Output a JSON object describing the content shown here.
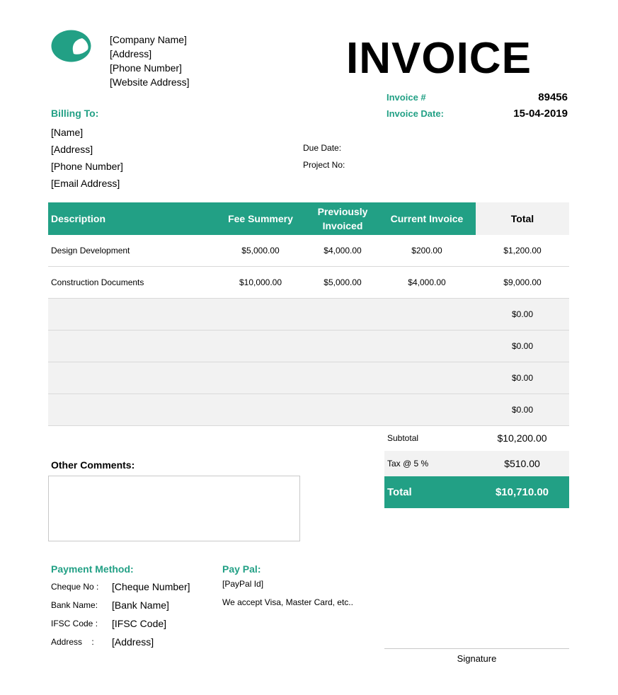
{
  "brand": {
    "accent": "#22a085",
    "logo_icon": "crescent-logo-icon"
  },
  "company": {
    "name": "[Company Name]",
    "address": "[Address]",
    "phone": "[Phone Number]",
    "website": "[Website Address]"
  },
  "title": "INVOICE",
  "invoice": {
    "number_label": "Invoice #",
    "number": "89456",
    "date_label": "Invoice Date:",
    "date": "15-04-2019",
    "due_label": "Due Date:",
    "project_label": "Project No:"
  },
  "billing": {
    "heading": "Billing To:",
    "name": "[Name]",
    "address": "[Address]",
    "phone": "[Phone Number]",
    "email": "[Email Address]"
  },
  "table": {
    "headers": {
      "description": "Description",
      "fee": "Fee Summery",
      "previously": "Previously Invoiced",
      "current": "Current Invoice",
      "total": "Total"
    },
    "rows": [
      {
        "description": "Design Development",
        "fee": "$5,000.00",
        "previously": "$4,000.00",
        "current": "$200.00",
        "total": "$1,200.00"
      },
      {
        "description": "Construction Documents",
        "fee": "$10,000.00",
        "previously": "$5,000.00",
        "current": "$4,000.00",
        "total": "$9,000.00"
      },
      {
        "description": "",
        "fee": "",
        "previously": "",
        "current": "",
        "total": "$0.00"
      },
      {
        "description": "",
        "fee": "",
        "previously": "",
        "current": "",
        "total": "$0.00"
      },
      {
        "description": "",
        "fee": "",
        "previously": "",
        "current": "",
        "total": "$0.00"
      },
      {
        "description": "",
        "fee": "",
        "previously": "",
        "current": "",
        "total": "$0.00"
      }
    ]
  },
  "summary": {
    "subtotal_label": "Subtotal",
    "subtotal": "$10,200.00",
    "tax_label": "Tax @ 5 %",
    "tax": "$510.00",
    "total_label": "Total",
    "total": "$10,710.00"
  },
  "comments": {
    "heading": "Other Comments:",
    "text": ""
  },
  "payment": {
    "heading": "Payment Method:",
    "cheque_label": "Cheque No :",
    "cheque": "[Cheque Number]",
    "bank_label": "Bank Name:",
    "bank": "[Bank Name]",
    "ifsc_label": "IFSC Code :",
    "ifsc": "[IFSC Code]",
    "address_label": "Address    :",
    "address": "[Address]"
  },
  "paypal": {
    "heading": "Pay Pal:",
    "id": "[PayPal Id]",
    "note": "We accept Visa, Master Card, etc.."
  },
  "signature": {
    "label": "Signature"
  }
}
